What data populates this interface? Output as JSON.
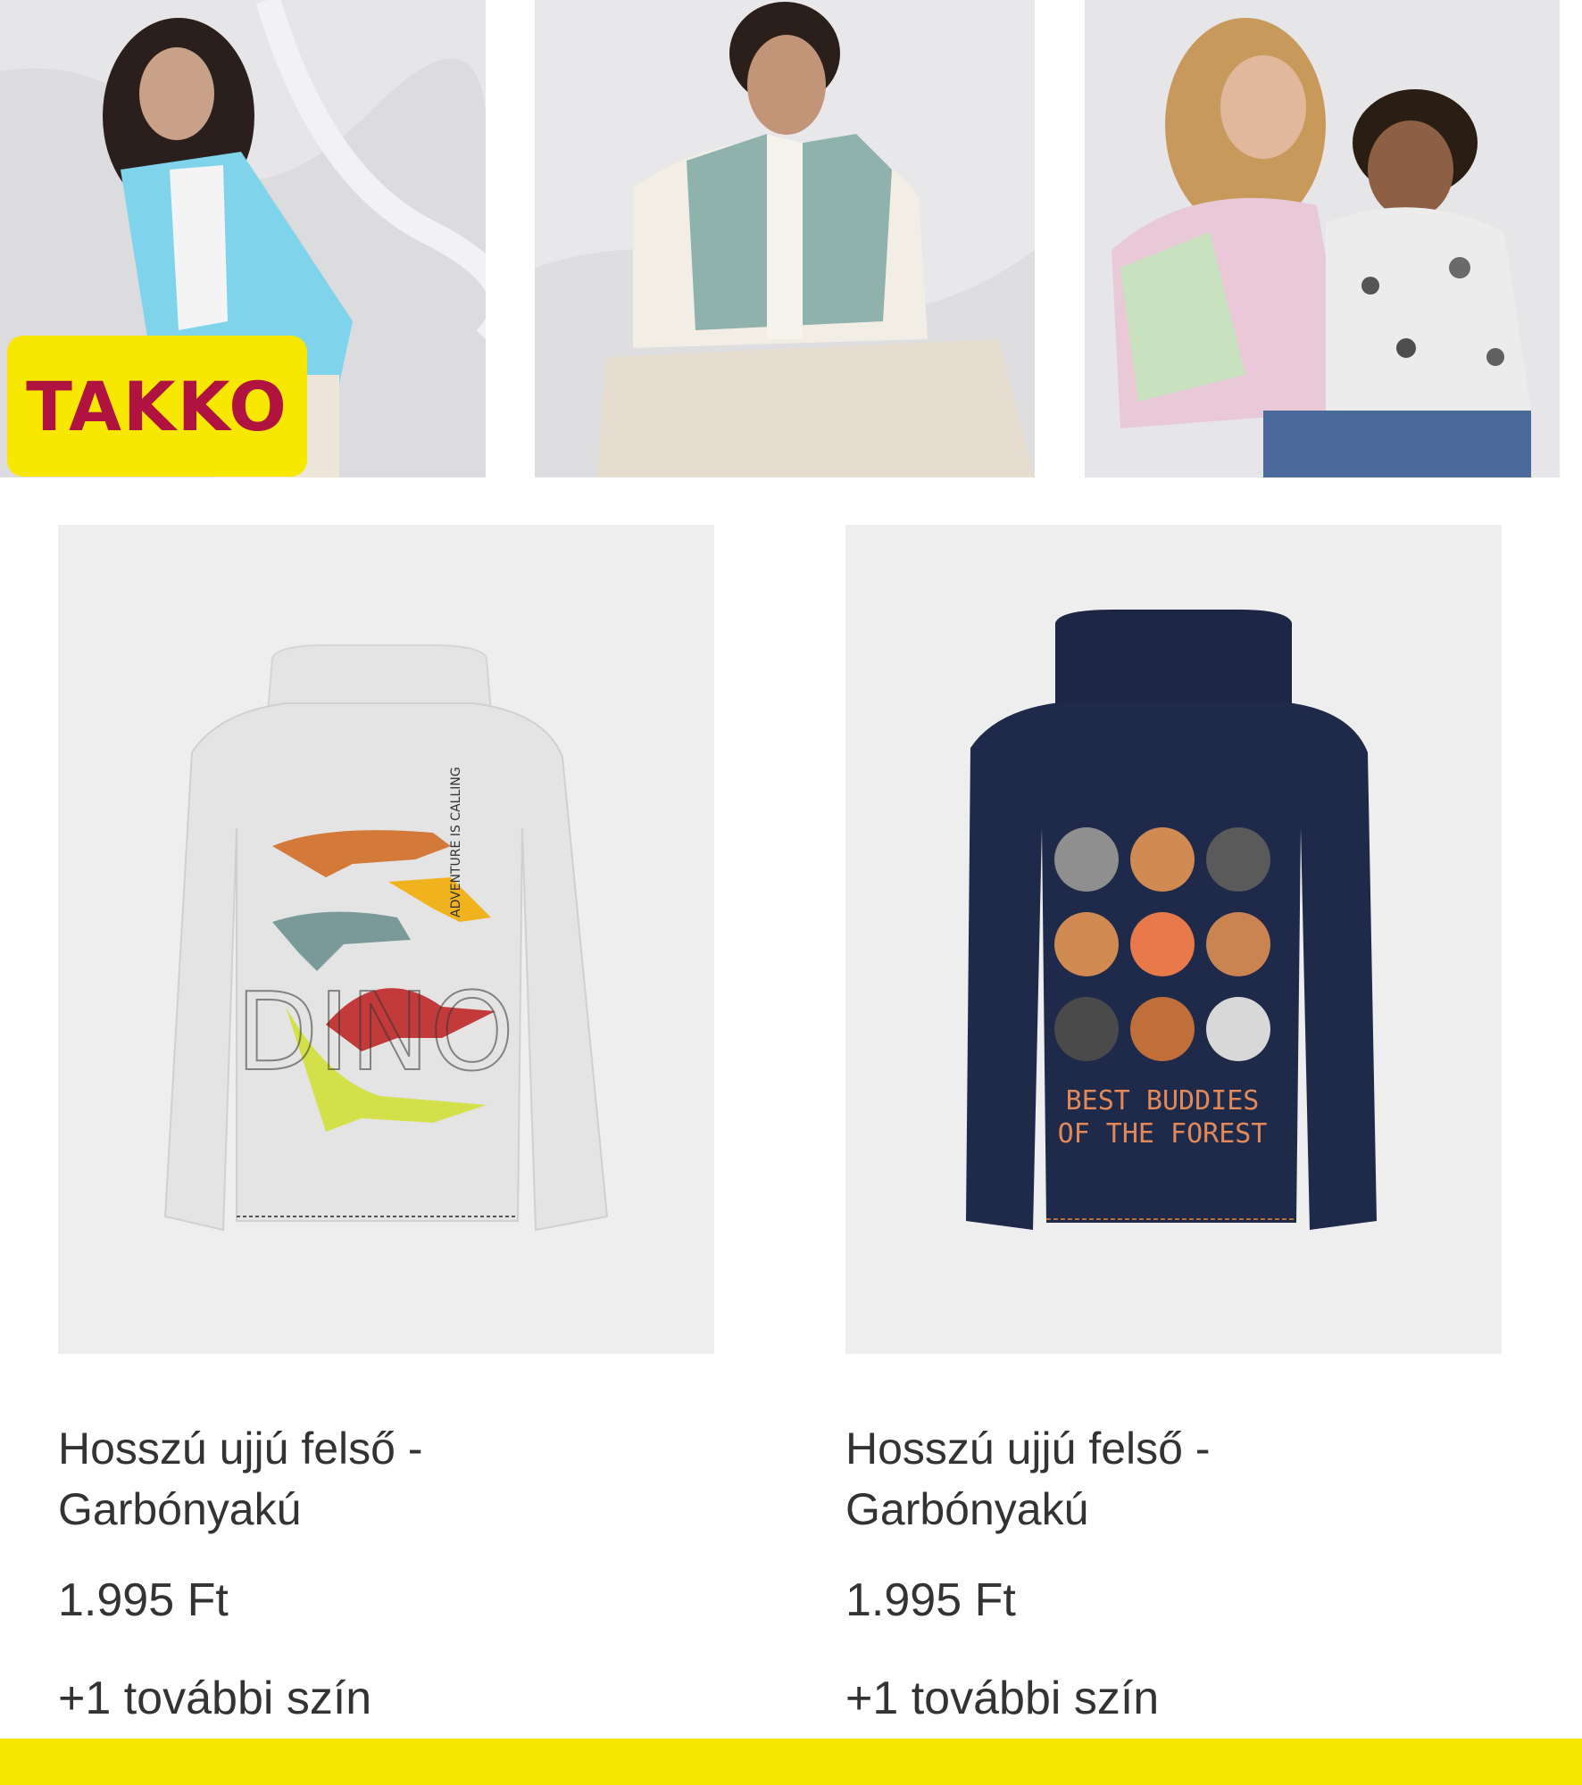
{
  "brand": {
    "logo_text": "TAKKO",
    "colors": {
      "yellow": "#f8e800",
      "logo_red": "#b0133f"
    }
  },
  "hero_images": [
    {
      "subject": "woman-in-light-blue-shirt"
    },
    {
      "subject": "man-in-mint-quilted-vest"
    },
    {
      "subject": "girl-and-boy-laughing"
    }
  ],
  "products": [
    {
      "name": "Hosszú ujjú felső - Garbónyakú",
      "price": "1.995 Ft",
      "colors_note": "+1 további szín",
      "image": {
        "garment_color": "#e4e4e4",
        "print_lines": [
          "DINO",
          "ADVENTURE IS CALLING"
        ]
      }
    },
    {
      "name": "Hosszú ujjú felső - Garbónyakú",
      "price": "1.995 Ft",
      "colors_note": "+1 további szín",
      "image": {
        "garment_color": "#1f2a4a",
        "print_lines": [
          "BEST  BUDDIES",
          "OF THE FOREST"
        ]
      }
    }
  ]
}
